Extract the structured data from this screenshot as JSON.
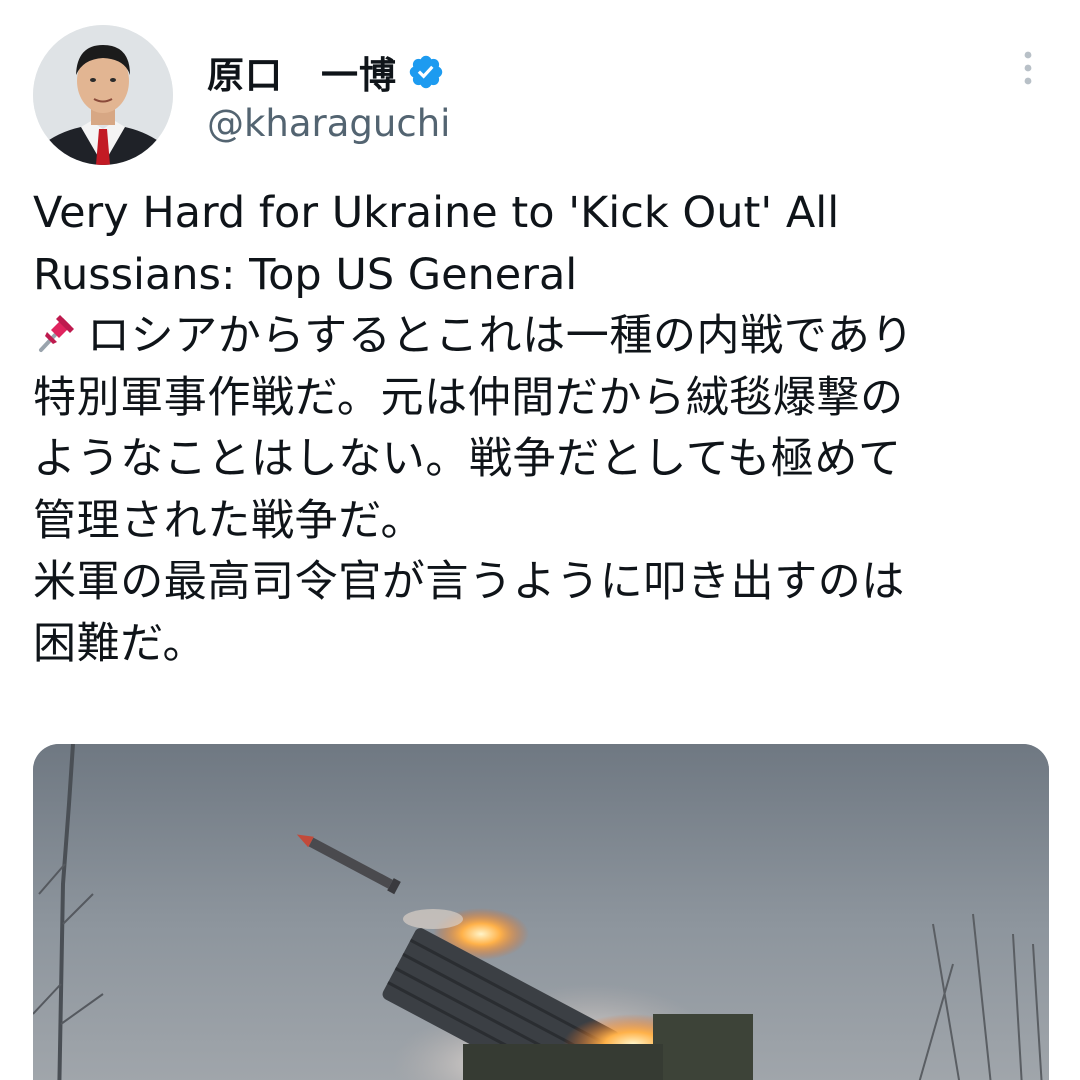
{
  "author": {
    "display_name": "原口　一博",
    "handle": "@kharaguchi",
    "verified": true,
    "avatar_icon": "person-avatar"
  },
  "menu": {
    "icon": "more-vertical-icon"
  },
  "tweet": {
    "text_lines": [
      "Very Hard for Ukraine to 'Kick Out' All",
      "Russians: Top US General",
      "ロシアからするとこれは一種の内戦であり",
      "特別軍事作戦だ。元は仲間だから絨毯爆撃の",
      "ようなことはしない。戦争だとしても極めて",
      "管理された戦争だ。",
      "米軍の最高司令官が言うように叩き出すのは",
      "困難だ。"
    ],
    "pin_icon": "pushpin-emoji"
  },
  "media": {
    "kind": "photo",
    "icon": "rocket-launcher-photo"
  },
  "colors": {
    "text": "#0f1419",
    "secondary": "#536471",
    "verified": "#1d9bf0",
    "pin": "#e0245e"
  }
}
